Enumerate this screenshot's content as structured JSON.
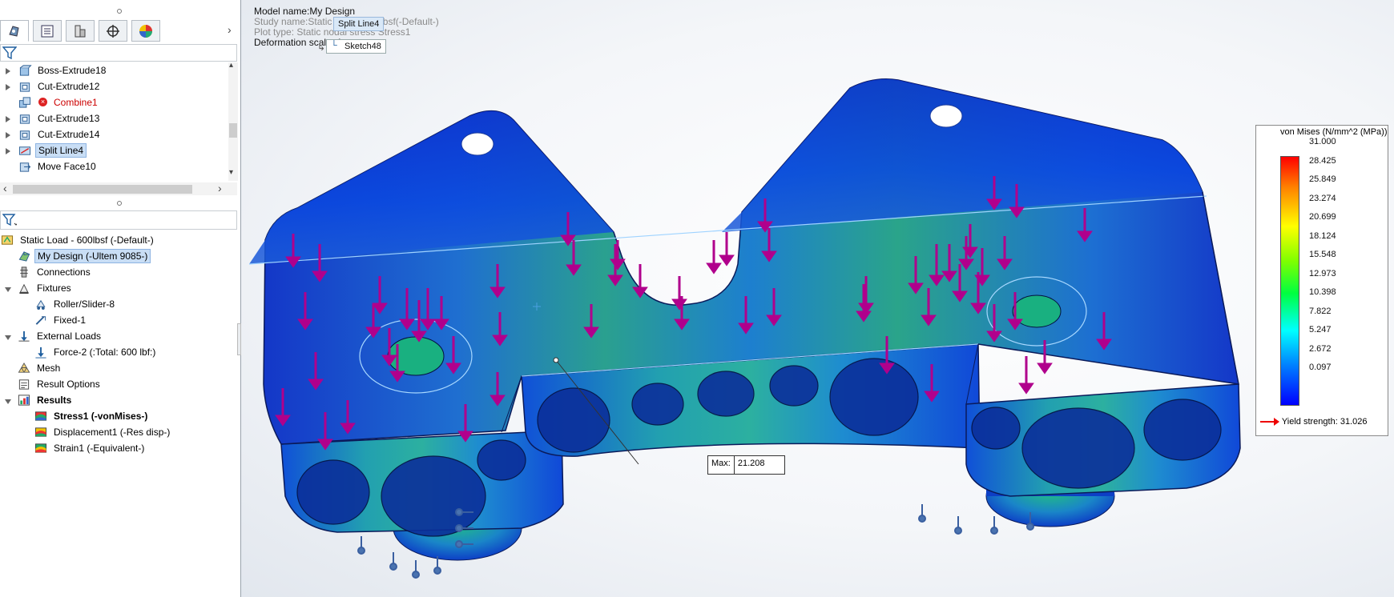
{
  "feature_tree": {
    "items": [
      {
        "label": "Boss-Extrude18",
        "icon": "boss-extrude-icon",
        "expandable": true
      },
      {
        "label": "Cut-Extrude12",
        "icon": "cut-extrude-icon",
        "expandable": true
      },
      {
        "label": "Combine1",
        "icon": "combine-icon",
        "expandable": false,
        "error": true
      },
      {
        "label": "Cut-Extrude13",
        "icon": "cut-extrude-icon",
        "expandable": true
      },
      {
        "label": "Cut-Extrude14",
        "icon": "cut-extrude-icon",
        "expandable": true
      },
      {
        "label": "Split Line4",
        "icon": "split-line-icon",
        "expandable": true,
        "selected": true
      },
      {
        "label": "Move Face10",
        "icon": "move-face-icon",
        "expandable": false
      }
    ]
  },
  "study_tree": {
    "items": [
      {
        "label": "Static Load - 600lbsf (-Default-)",
        "icon": "static-study-icon",
        "level": 0
      },
      {
        "label": "My Design (-Ultem 9085-)",
        "icon": "part-icon",
        "level": 1,
        "selected": true
      },
      {
        "label": "Connections",
        "icon": "connections-icon",
        "level": 1
      },
      {
        "label": "Fixtures",
        "icon": "fixtures-icon",
        "level": 1,
        "expandable": true
      },
      {
        "label": "Roller/Slider-8",
        "icon": "roller-slider-icon",
        "level": 2
      },
      {
        "label": "Fixed-1",
        "icon": "fixed-icon",
        "level": 2
      },
      {
        "label": "External Loads",
        "icon": "external-loads-icon",
        "level": 1,
        "expandable": true
      },
      {
        "label": "Force-2 (:Total: 600 lbf:)",
        "icon": "force-icon",
        "level": 2
      },
      {
        "label": "Mesh",
        "icon": "mesh-icon",
        "level": 1
      },
      {
        "label": "Result Options",
        "icon": "result-options-icon",
        "level": 1
      },
      {
        "label": "Results",
        "icon": "results-icon",
        "level": 1,
        "expandable": true,
        "bold": true
      },
      {
        "label": "Stress1 (-vonMises-)",
        "icon": "stress-plot-icon",
        "level": 2,
        "bold": true
      },
      {
        "label": "Displacement1 (-Res disp-)",
        "icon": "displacement-plot-icon",
        "level": 2
      },
      {
        "label": "Strain1 (-Equivalent-)",
        "icon": "strain-plot-icon",
        "level": 2
      }
    ]
  },
  "viewport": {
    "model_name": "Model name:My Design",
    "study_name": "Study name:Static Load - 600lbsf(-Default-)",
    "plot_type": "Plot type: Static nodal stress Stress1",
    "deformation_scale": "Deformation scale: 1",
    "hud_split_line": "Split Line4",
    "hud_sketch": "Sketch48"
  },
  "legend": {
    "title": "von Mises (N/mm^2 (MPa))",
    "ticks": [
      "31.000",
      "28.425",
      "25.849",
      "23.274",
      "20.699",
      "18.124",
      "15.548",
      "12.973",
      "10.398",
      "7.822",
      "5.247",
      "2.672",
      "0.097"
    ],
    "yield": "Yield strength: 31.026"
  },
  "probe": {
    "label": "Max:",
    "value": "21.208"
  }
}
